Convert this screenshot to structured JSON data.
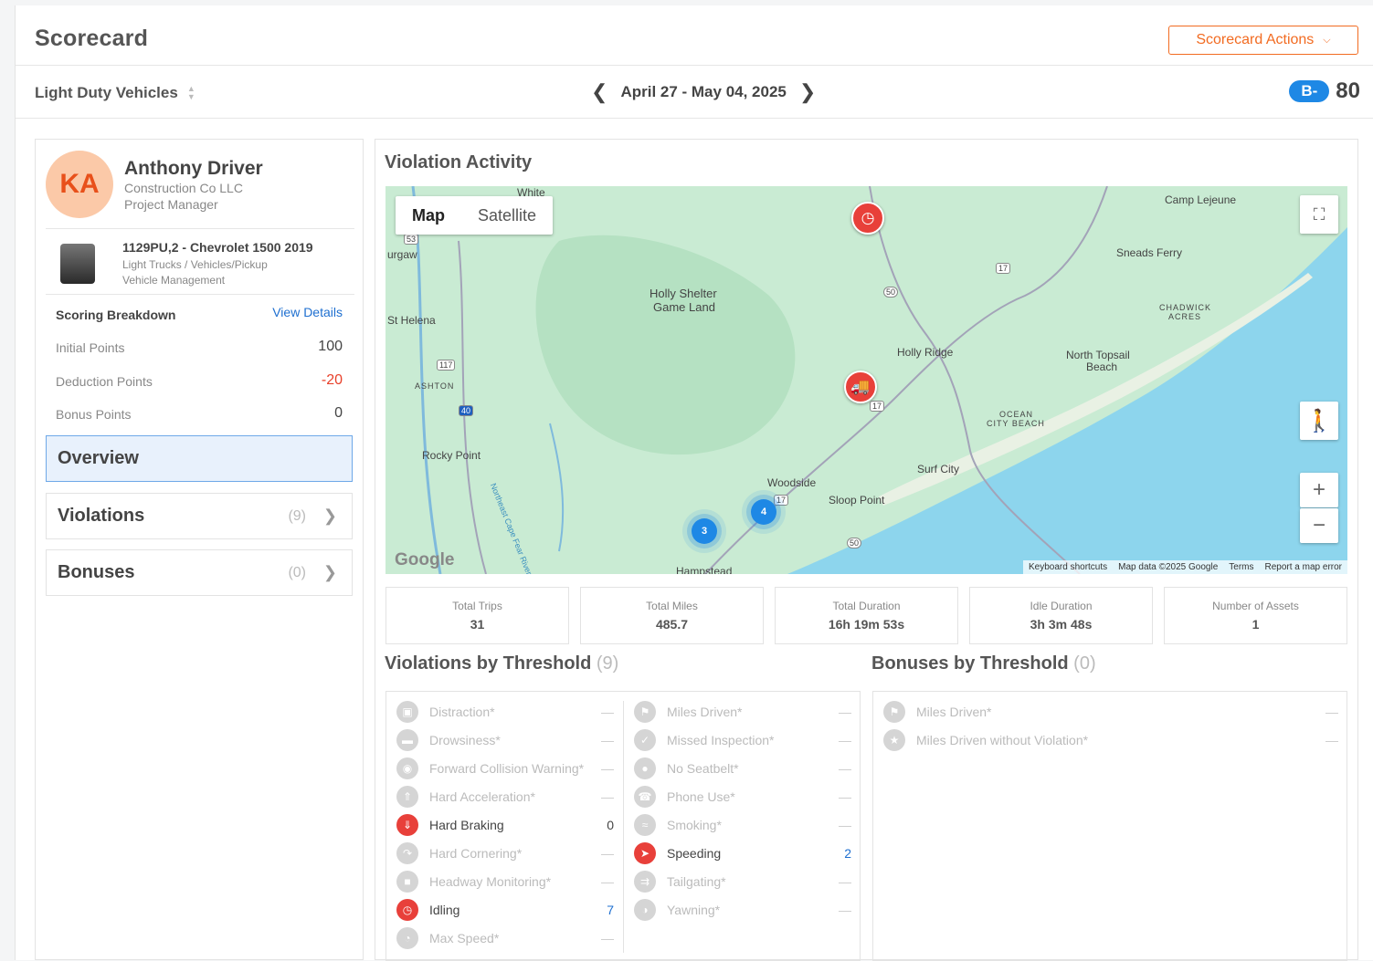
{
  "header": {
    "title": "Scorecard",
    "actions_label": "Scorecard Actions",
    "group_label": "Light Duty Vehicles",
    "date_range": "April 27 - May 04, 2025",
    "grade": "B-",
    "score": "80"
  },
  "driver": {
    "initials": "KA",
    "name": "Anthony Driver",
    "company": "Construction Co LLC",
    "role": "Project Manager"
  },
  "vehicle": {
    "name": "1129PU,2 - Chevrolet 1500 2019",
    "type": "Light Trucks / Vehicles/Pickup",
    "group": "Vehicle Management"
  },
  "breakdown": {
    "title": "Scoring Breakdown",
    "view_details": "View Details",
    "initial_label": "Initial Points",
    "initial_value": "100",
    "deduction_label": "Deduction Points",
    "deduction_value": "-20",
    "bonus_label": "Bonus Points",
    "bonus_value": "0"
  },
  "nav": {
    "overview": "Overview",
    "violations": "Violations",
    "violations_count": "(9)",
    "bonuses": "Bonuses",
    "bonuses_count": "(0)"
  },
  "map": {
    "section_title": "Violation Activity",
    "tab_map": "Map",
    "tab_satellite": "Satellite",
    "labels": [
      "White",
      "urgaw",
      "St Helena",
      "Holly Shelter",
      "Game Land",
      "ASHTON",
      "Rocky Point",
      "Woodside",
      "Sloop Point",
      "Surf City",
      "Holly Ridge",
      "North Topsail",
      "Beach",
      "OCEAN",
      "CITY BEACH",
      "Camp Lejeune",
      "Sneads Ferry",
      "CHADWICK",
      "ACRES",
      "Hampstead",
      "Northeast Cape Fear River"
    ],
    "route_shields": [
      "53",
      "117",
      "40",
      "17",
      "50",
      "17",
      "17",
      "50"
    ],
    "clusters": [
      "3",
      "4"
    ],
    "footer_shortcuts": "Keyboard shortcuts",
    "footer_data": "Map data ©2025 Google",
    "footer_terms": "Terms",
    "footer_report": "Report a map error",
    "google": "Google"
  },
  "stats": [
    {
      "label": "Total Trips",
      "value": "31"
    },
    {
      "label": "Total Miles",
      "value": "485.7"
    },
    {
      "label": "Total Duration",
      "value": "16h 19m 53s"
    },
    {
      "label": "Idle Duration",
      "value": "3h 3m 48s"
    },
    {
      "label": "Number of Assets",
      "value": "1"
    }
  ],
  "violations_by_threshold": {
    "title": "Violations by Threshold",
    "count": "(9)",
    "col1": [
      {
        "label": "Distraction*",
        "value": "—",
        "active": false,
        "icon": "distraction-icon"
      },
      {
        "label": "Drowsiness*",
        "value": "—",
        "active": false,
        "icon": "drowsiness-icon"
      },
      {
        "label": "Forward Collision Warning*",
        "value": "—",
        "active": false,
        "icon": "collision-icon"
      },
      {
        "label": "Hard Acceleration*",
        "value": "—",
        "active": false,
        "icon": "acceleration-icon"
      },
      {
        "label": "Hard Braking",
        "value": "0",
        "active": true,
        "icon": "braking-icon"
      },
      {
        "label": "Hard Cornering*",
        "value": "—",
        "active": false,
        "icon": "cornering-icon"
      },
      {
        "label": "Headway Monitoring*",
        "value": "—",
        "active": false,
        "icon": "headway-icon"
      },
      {
        "label": "Idling",
        "value": "7",
        "active": true,
        "icon": "clock-icon"
      },
      {
        "label": "Max Speed*",
        "value": "—",
        "active": false,
        "icon": "speedometer-icon"
      }
    ],
    "col2": [
      {
        "label": "Miles Driven*",
        "value": "—",
        "active": false,
        "icon": "flag-icon"
      },
      {
        "label": "Missed Inspection*",
        "value": "—",
        "active": false,
        "icon": "inspection-icon"
      },
      {
        "label": "No Seatbelt*",
        "value": "—",
        "active": false,
        "icon": "seatbelt-icon"
      },
      {
        "label": "Phone Use*",
        "value": "—",
        "active": false,
        "icon": "phone-icon"
      },
      {
        "label": "Smoking*",
        "value": "—",
        "active": false,
        "icon": "smoking-icon"
      },
      {
        "label": "Speeding",
        "value": "2",
        "active": true,
        "icon": "speeding-icon"
      },
      {
        "label": "Tailgating*",
        "value": "—",
        "active": false,
        "icon": "tailgating-icon"
      },
      {
        "label": "Yawning*",
        "value": "—",
        "active": false,
        "icon": "yawning-icon"
      }
    ]
  },
  "bonuses_by_threshold": {
    "title": "Bonuses by Threshold",
    "count": "(0)",
    "items": [
      {
        "label": "Miles Driven*",
        "value": "—",
        "icon": "flag-icon"
      },
      {
        "label": "Miles Driven without Violation*",
        "value": "—",
        "icon": "trophy-icon"
      }
    ]
  },
  "colors": {
    "accent_orange": "#f26b21",
    "link_blue": "#1e6fd0",
    "alert_red": "#e8403a",
    "grade_blue": "#1e88e5",
    "water": "#8dd5ed",
    "land": "#c9ebd3"
  }
}
